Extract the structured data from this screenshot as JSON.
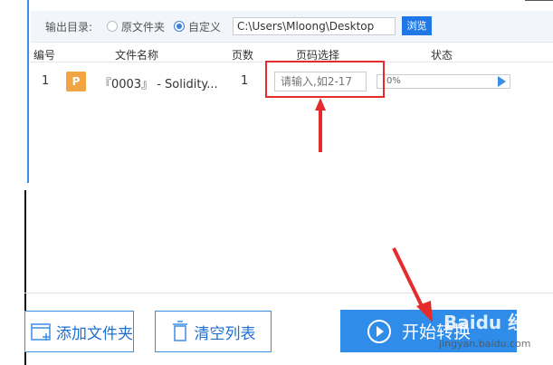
{
  "output": {
    "label": "输出目录:",
    "option_original": "原文件夹",
    "option_custom": "自定义",
    "selected": "自定义",
    "path_value": "C:\\Users\\Mloong\\Desktop",
    "browse_label": "浏览"
  },
  "table": {
    "headers": [
      "编号",
      "文件名称",
      "页数",
      "页码选择",
      "状态"
    ],
    "rows": [
      {
        "index": "1",
        "file_icon_letter": "P",
        "file_name": "『0003』 - Solidity...",
        "pages": "1",
        "page_select_placeholder": "请输入,如2-17",
        "status_progress": "0%"
      }
    ]
  },
  "buttons": {
    "add_folder": "添加文件夹",
    "clear_list": "清空列表",
    "start": "开始转换"
  },
  "watermark": {
    "text": "Baidu 经验",
    "url": "jingyan.baidu.com"
  },
  "colors": {
    "accent": "#1f78e6",
    "annotation_red": "#e52b2b",
    "file_icon": "#f0a443"
  }
}
